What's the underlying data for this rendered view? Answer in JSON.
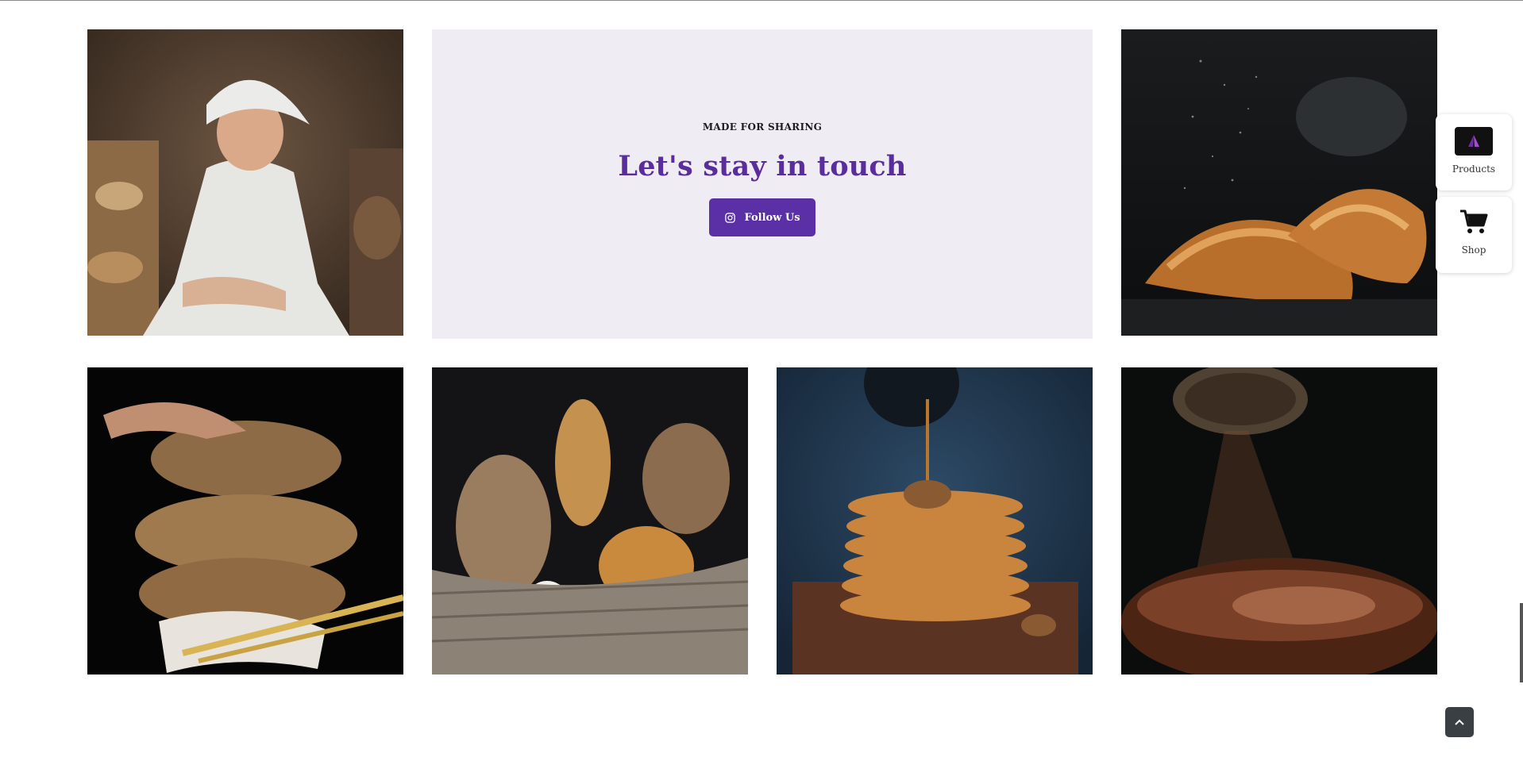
{
  "promo": {
    "eyebrow": "MADE FOR SHARING",
    "headline": "Let's stay in touch",
    "follow_button": "Follow Us",
    "follow_icon": "instagram-icon",
    "accent": "#5b2fa6",
    "background": "#efedf3"
  },
  "gallery": [
    {
      "name": "baker-woman-photo"
    },
    {
      "name": "croissants-photo"
    },
    {
      "name": "stacked-bread-loaves-photo"
    },
    {
      "name": "bread-basket-photo"
    },
    {
      "name": "pancakes-syrup-photo"
    },
    {
      "name": "cocoa-dusting-cake-photo"
    }
  ],
  "side_widgets": {
    "products_label": "Products",
    "shop_label": "Shop"
  },
  "scroll_top_icon": "chevron-up-icon"
}
